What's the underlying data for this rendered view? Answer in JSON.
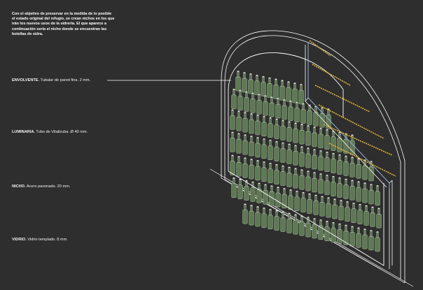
{
  "intro_text": "Con el objetivo de preservar en la medida de lo posible el estado original del refugio, se crean nichos en los que irán los nuevos usos de la sidrería. El que aparece a continuación sería el nicho donde se encuentran las botellas de sidra.",
  "labels": [
    {
      "key": "envolvente",
      "title": "ENVOLVENTE.",
      "detail": "Tubular de pared fina. 2 mm."
    },
    {
      "key": "luminaria",
      "title": "LUMINARIA.",
      "detail": "Tubo de Vitalizuba. Ø 40 mm."
    },
    {
      "key": "nicho",
      "title": "NICHO.",
      "detail": "Acero pavonado. 20 mm."
    },
    {
      "key": "vidrio",
      "title": "VIDRIO.",
      "detail": "Vidrio templado. 8 mm."
    }
  ],
  "colors": {
    "background": "#2e2e2e",
    "line": "#ffffff",
    "bottle_fill": "#5d7a52",
    "bottle_stroke": "#cfd8c8",
    "light_tube": "#e2b23a",
    "glass_edge": "#8fb3d9"
  }
}
